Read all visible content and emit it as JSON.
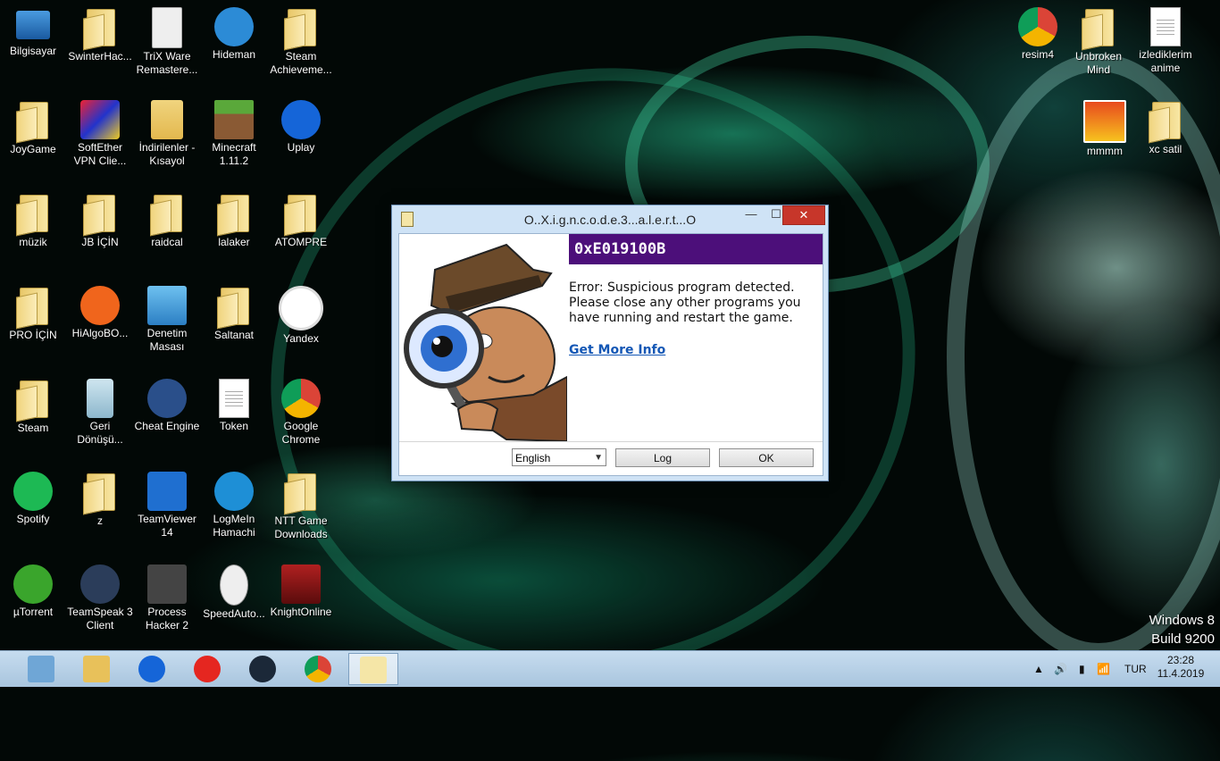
{
  "desktop": {
    "left_columns": [
      [
        {
          "label": "Bilgisayar",
          "icon": "computer-icon"
        },
        {
          "label": "JoyGame",
          "icon": "folder-icon"
        },
        {
          "label": "müzik",
          "icon": "folder-icon"
        },
        {
          "label": "PRO İÇİN",
          "icon": "folder-icon"
        },
        {
          "label": "Steam",
          "icon": "folder-icon"
        },
        {
          "label": "Spotify",
          "icon": "spotify-icon"
        },
        {
          "label": "µTorrent",
          "icon": "utorrent-icon"
        }
      ],
      [
        {
          "label": "SwinterHac...",
          "icon": "folder-icon"
        },
        {
          "label": "SoftEther VPN Clie...",
          "icon": "softether-icon"
        },
        {
          "label": "JB İÇİN",
          "icon": "folder-icon"
        },
        {
          "label": "HiAlgoBO...",
          "icon": "hialgo-icon"
        },
        {
          "label": "Geri Dönüşü...",
          "icon": "recycle-bin-icon"
        },
        {
          "label": "z",
          "icon": "folder-icon"
        },
        {
          "label": "TeamSpeak 3 Client",
          "icon": "teamspeak-icon"
        }
      ],
      [
        {
          "label": "TriX Ware Remastere...",
          "icon": "settings-doc-icon"
        },
        {
          "label": "İndirilenler - Kısayol",
          "icon": "downloads-folder-icon"
        },
        {
          "label": "raidcal",
          "icon": "folder-icon"
        },
        {
          "label": "Denetim Masası",
          "icon": "control-panel-icon"
        },
        {
          "label": "Cheat Engine",
          "icon": "cheat-engine-icon"
        },
        {
          "label": "TeamViewer 14",
          "icon": "teamviewer-icon"
        },
        {
          "label": "Process Hacker 2",
          "icon": "process-hacker-icon"
        }
      ],
      [
        {
          "label": "Hideman",
          "icon": "hideman-icon"
        },
        {
          "label": "Minecraft 1.11.2",
          "icon": "minecraft-icon"
        },
        {
          "label": "lalaker",
          "icon": "folder-icon"
        },
        {
          "label": "Saltanat",
          "icon": "folder-icon"
        },
        {
          "label": "Token",
          "icon": "text-document-icon"
        },
        {
          "label": "LogMeIn Hamachi",
          "icon": "hamachi-icon"
        },
        {
          "label": "SpeedAuto...",
          "icon": "mouse-icon"
        }
      ],
      [
        {
          "label": "Steam Achieveme...",
          "icon": "folder-icon"
        },
        {
          "label": "Uplay",
          "icon": "uplay-icon"
        },
        {
          "label": "ATOMPRE",
          "icon": "folder-icon"
        },
        {
          "label": "Yandex",
          "icon": "yandex-icon"
        },
        {
          "label": "Google Chrome",
          "icon": "chrome-icon"
        },
        {
          "label": "NTT Game Downloads",
          "icon": "folder-icon"
        },
        {
          "label": "KnightOnline",
          "icon": "knight-online-icon"
        }
      ]
    ],
    "right_icons": [
      {
        "label": "resim4",
        "icon": "chrome-icon"
      },
      {
        "label": "Unbroken Mind",
        "icon": "folder-icon"
      },
      {
        "label": "izlediklerim anime",
        "icon": "text-document-icon"
      },
      {
        "label": "mmmm",
        "icon": "image-icon"
      },
      {
        "label": "xc satil",
        "icon": "folder-icon"
      }
    ],
    "watermark": {
      "line1": "Windows 8",
      "line2": "Build 9200"
    }
  },
  "dialog": {
    "title": "O..X.i.g.n.c.o.d.e.3...a.l.e.r.t...O",
    "error_code": "0xE019100B",
    "message": "Error: Suspicious program detected. Please close any other programs you have running and restart the game.",
    "link": "Get More Info",
    "language": "English",
    "log_button": "Log",
    "ok_button": "OK",
    "min_glyph": "—",
    "max_glyph": "☐",
    "close_glyph": "✕"
  },
  "taskbar": {
    "apps": [
      {
        "name": "computer",
        "active": false
      },
      {
        "name": "file-explorer",
        "active": false
      },
      {
        "name": "uplay",
        "active": false
      },
      {
        "name": "yandex",
        "active": false
      },
      {
        "name": "steam",
        "active": false
      },
      {
        "name": "chrome",
        "active": false
      },
      {
        "name": "clipboard-app",
        "active": true
      }
    ],
    "tray": {
      "language": "TUR",
      "time": "23:28",
      "date": "11.4.2019",
      "up_arrow": "▲"
    }
  },
  "colors": {
    "error_banner": "#4c0f7a",
    "link": "#1457b5",
    "close": "#c7362a"
  }
}
